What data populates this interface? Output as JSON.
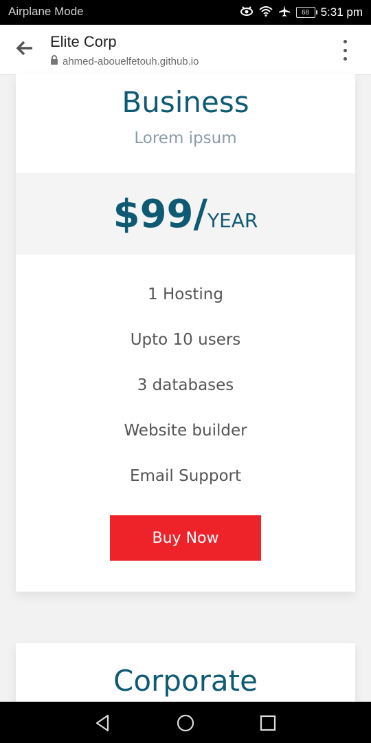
{
  "status_bar": {
    "mode": "Airplane Mode",
    "battery": "68",
    "time": "5:31 pm"
  },
  "toolbar": {
    "title": "Elite Corp",
    "url": "ahmed-abouelfetouh.github.io"
  },
  "plans": [
    {
      "title": "Business",
      "subtitle": "Lorem ipsum",
      "price": "$99/",
      "period": "YEAR",
      "features": [
        "1 Hosting",
        "Upto 10 users",
        "3 databases",
        "Website builder",
        "Email Support"
      ],
      "button": "Buy Now"
    },
    {
      "title": "Corporate"
    }
  ],
  "colors": {
    "accent": "#0f5a73",
    "button": "#ee2229"
  }
}
